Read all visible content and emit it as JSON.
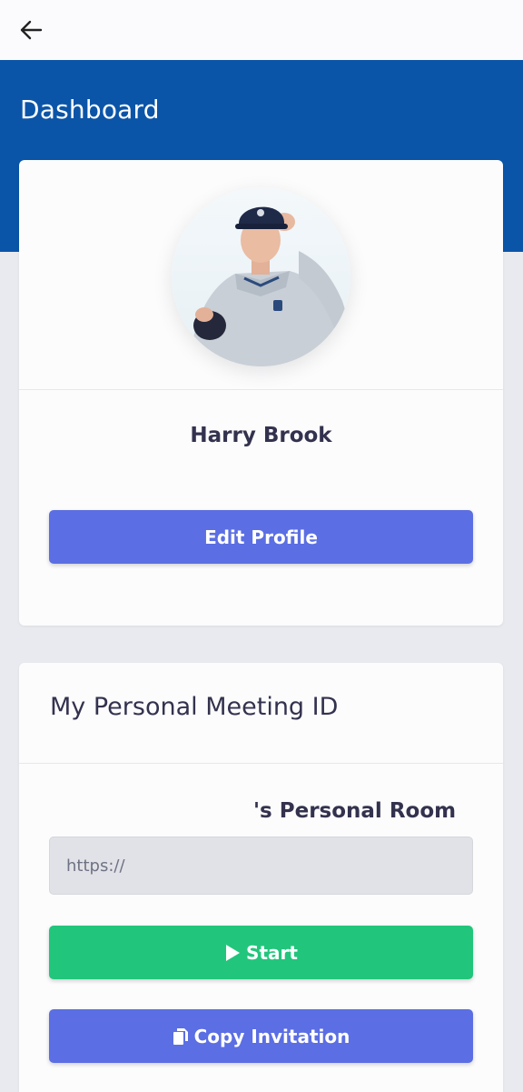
{
  "header": {
    "back_icon": "arrow-left-icon",
    "title": "Dashboard",
    "brand_color": "#0b55a8"
  },
  "profile": {
    "name": "Harry Brook",
    "edit_button": "Edit Profile"
  },
  "meeting": {
    "heading": "My Personal Meeting ID",
    "room_title": "'s Personal Room",
    "url_placeholder": "https://",
    "start_button": "Start",
    "start_icon": "play-icon",
    "copy_button": "Copy Invitation",
    "copy_icon": "copy-icon"
  },
  "colors": {
    "primary_button": "#5b6ee3",
    "start_button": "#22c57c"
  }
}
